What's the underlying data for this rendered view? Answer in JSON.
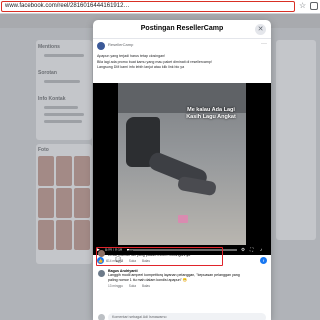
{
  "browser": {
    "url": "www.facebook.com/reel/2816016444161912…"
  },
  "background": {
    "sidebar_labels": [
      "Mentions",
      "Sorotan",
      "Info Kontak",
      "Foto"
    ]
  },
  "modal": {
    "title": "Postingan ResellerCamp",
    "poster": "ResellerCamp",
    "caption_lines": [
      "Apapun yang terjadi harus tetap closingan!",
      "Bila lagi ada promo buat kamu yang mau paket diminati di resellercamp!",
      "Langsung DM kami info lebih lanjut atau klik link bio ya"
    ],
    "video": {
      "overlay_lines": [
        "Me kalau Ada Lagi",
        "Kasih Lagu Angkat"
      ],
      "current_time": "0:00 / 0:19",
      "progress_pct": 2
    },
    "reactions": {
      "likes": "6",
      "comments": "2"
    },
    "comments": [
      {
        "name": "indi ecosaurus",
        "text_lines": [
          "Emak mamah lah yang pasalo Iniform closingannya"
        ],
        "actions": [
          "14 minggu",
          "Suka",
          "Balas"
        ]
      },
      {
        "name": "Bagus Andriyanti",
        "text_lines": [
          "Langgih modil ampeel kompetitorq layanan pelanggan, \"kepuasan pelanggan yang",
          "paling nomor 1 itu mah dalam kondisi apapun\" 😁"
        ],
        "actions": [
          "13 minggu",
          "Suka",
          "Balas"
        ]
      }
    ],
    "write_comment_placeholder": "Komentari sebagai Adi Ismawarno"
  },
  "colors": {
    "accent": "#1877f2",
    "highlight": "#e0242b"
  }
}
